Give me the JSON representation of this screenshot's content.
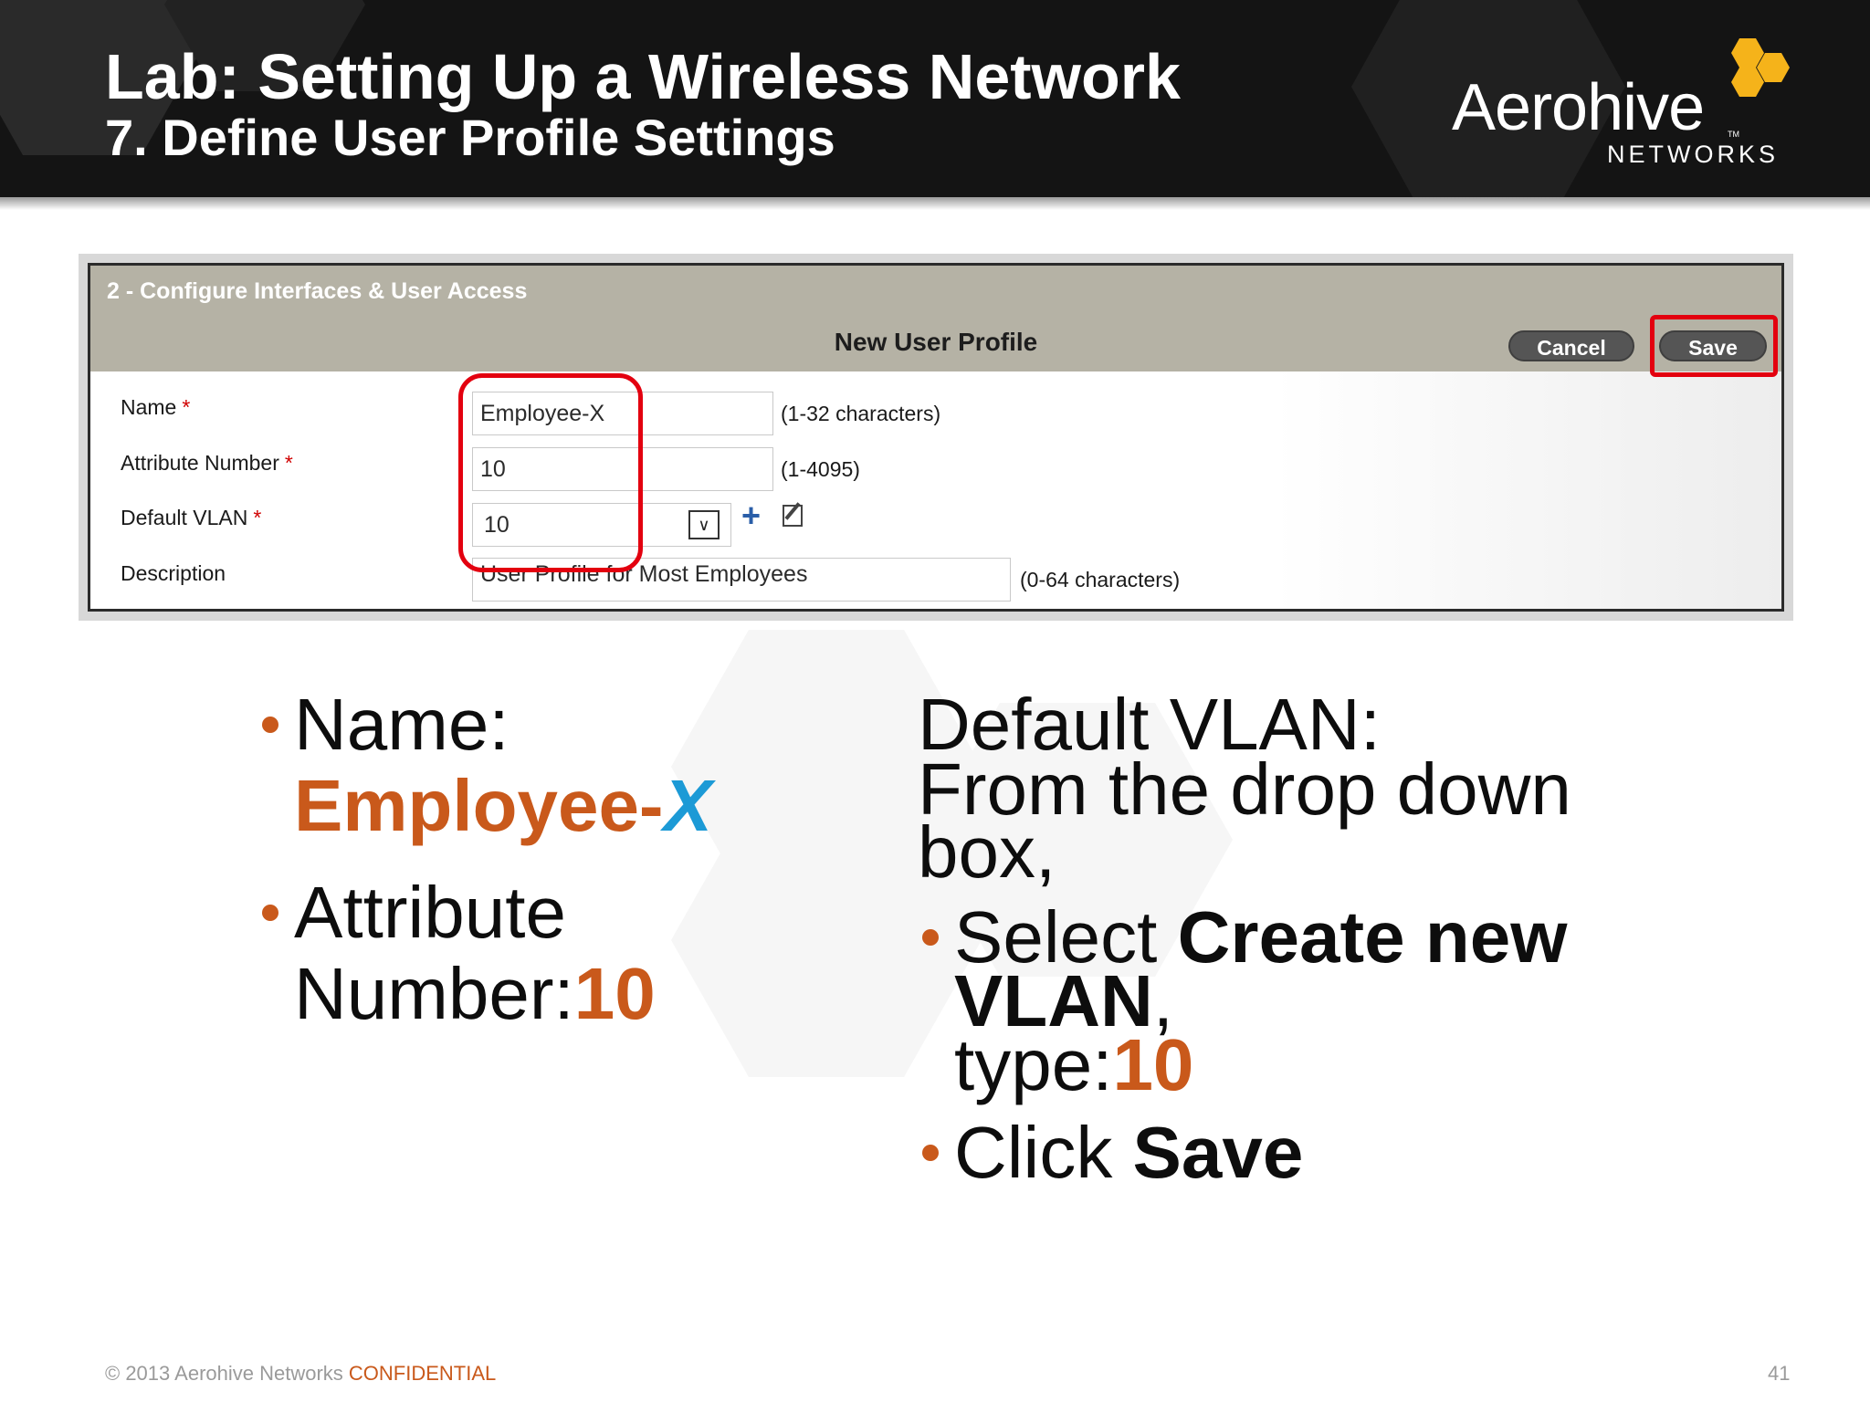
{
  "slide": {
    "title": "Lab: Setting Up a Wireless Network",
    "subtitle": "7. Define User Profile Settings"
  },
  "logo": {
    "wordmark": "Aerohive",
    "subtext": "NETWORKS",
    "tm": "TM"
  },
  "form": {
    "section_title": "2 - Configure Interfaces & User Access",
    "form_title": "New User Profile",
    "cancel_label": "Cancel",
    "save_label": "Save",
    "required_mark": "*",
    "fields": {
      "name": {
        "label": "Name",
        "value": "Employee-X",
        "hint": "(1-32 characters)"
      },
      "attribute_number": {
        "label": "Attribute Number",
        "value": "10",
        "hint": "(1-4095)"
      },
      "default_vlan": {
        "label": "Default VLAN",
        "value": "10"
      },
      "description": {
        "label": "Description",
        "value": "User Profile for Most Employees",
        "hint": "(0-64 characters)"
      }
    }
  },
  "bullets": {
    "left": {
      "name_label": "Name:",
      "name_value_main": "Employee-",
      "name_value_x": "X",
      "attr_line1": "Attribute",
      "attr_line2": "Number:",
      "attr_value": "10"
    },
    "right": {
      "heading_line1": "Default VLAN:",
      "heading_line2": "From the drop down",
      "heading_line3": "box,",
      "select_word": "Select ",
      "create_new": "Create new",
      "vlan_word": "VLAN",
      "comma": ",",
      "type_label": "type:",
      "type_value": "10",
      "click_word": "Click ",
      "save_word": "Save"
    }
  },
  "footer": {
    "copyright": "© 2013 Aerohive Networks ",
    "confidential": "CONFIDENTIAL",
    "page_number": "41"
  },
  "colors": {
    "accent_orange": "#c9591b",
    "accent_blue": "#1c9ad6",
    "highlight_red": "#e3000f",
    "logo_yellow": "#f5b31a",
    "header_bg": "#141414"
  }
}
